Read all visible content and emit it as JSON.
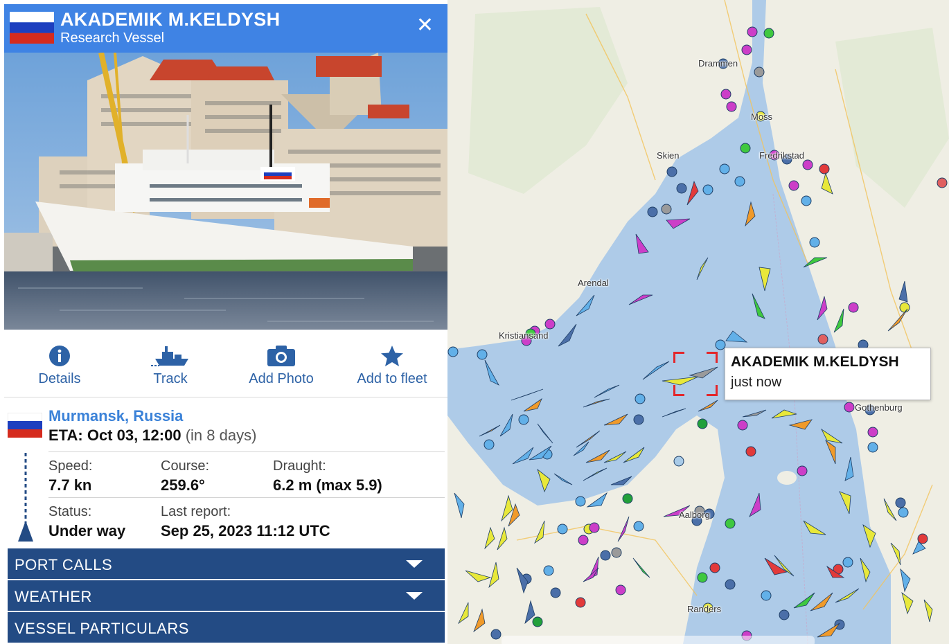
{
  "vessel": {
    "name": "AKADEMIK M.KELDYSH",
    "type": "Research Vessel",
    "flag_country": "Russia"
  },
  "actions": [
    {
      "label": "Details",
      "icon": "info-icon"
    },
    {
      "label": "Track",
      "icon": "ship-track-icon"
    },
    {
      "label": "Add Photo",
      "icon": "camera-icon"
    },
    {
      "label": "Add to fleet",
      "icon": "star-icon"
    }
  ],
  "voyage": {
    "destination": "Murmansk, Russia",
    "eta_label": "ETA:",
    "eta": "Oct 03, 12:00",
    "eta_relative": "(in 8 days)"
  },
  "stats": {
    "speed_label": "Speed:",
    "speed": "7.7 kn",
    "course_label": "Course:",
    "course": "259.6°",
    "draught_label": "Draught:",
    "draught": "6.2 m (max 5.9)",
    "status_label": "Status:",
    "status": "Under way",
    "last_report_label": "Last report:",
    "last_report": "Sep 25, 2023 11:12 UTC"
  },
  "sections": [
    "PORT CALLS",
    "WEATHER",
    "VESSEL PARTICULARS"
  ],
  "map": {
    "tooltip_name": "AKADEMIK M.KELDYSH",
    "tooltip_time": "just now",
    "places": [
      {
        "key": "drammen",
        "text": "Drammen"
      },
      {
        "key": "moss",
        "text": "Moss"
      },
      {
        "key": "skien",
        "text": "Skien"
      },
      {
        "key": "fredrikstad",
        "text": "Fredrikstad"
      },
      {
        "key": "arendal",
        "text": "Arendal"
      },
      {
        "key": "kristiansand",
        "text": "Kristiansand"
      },
      {
        "key": "gothenburg",
        "text": "Gothenburg"
      },
      {
        "key": "aalborg",
        "text": "Aalborg"
      },
      {
        "key": "randers",
        "text": "Randers"
      }
    ]
  },
  "colors": {
    "header_blue": "#3f83e4",
    "section_navy": "#234b84",
    "link_blue": "#2d62a6",
    "destination_blue": "#3b82d8",
    "sea": "#aecbe8",
    "land": "#efeee4"
  }
}
